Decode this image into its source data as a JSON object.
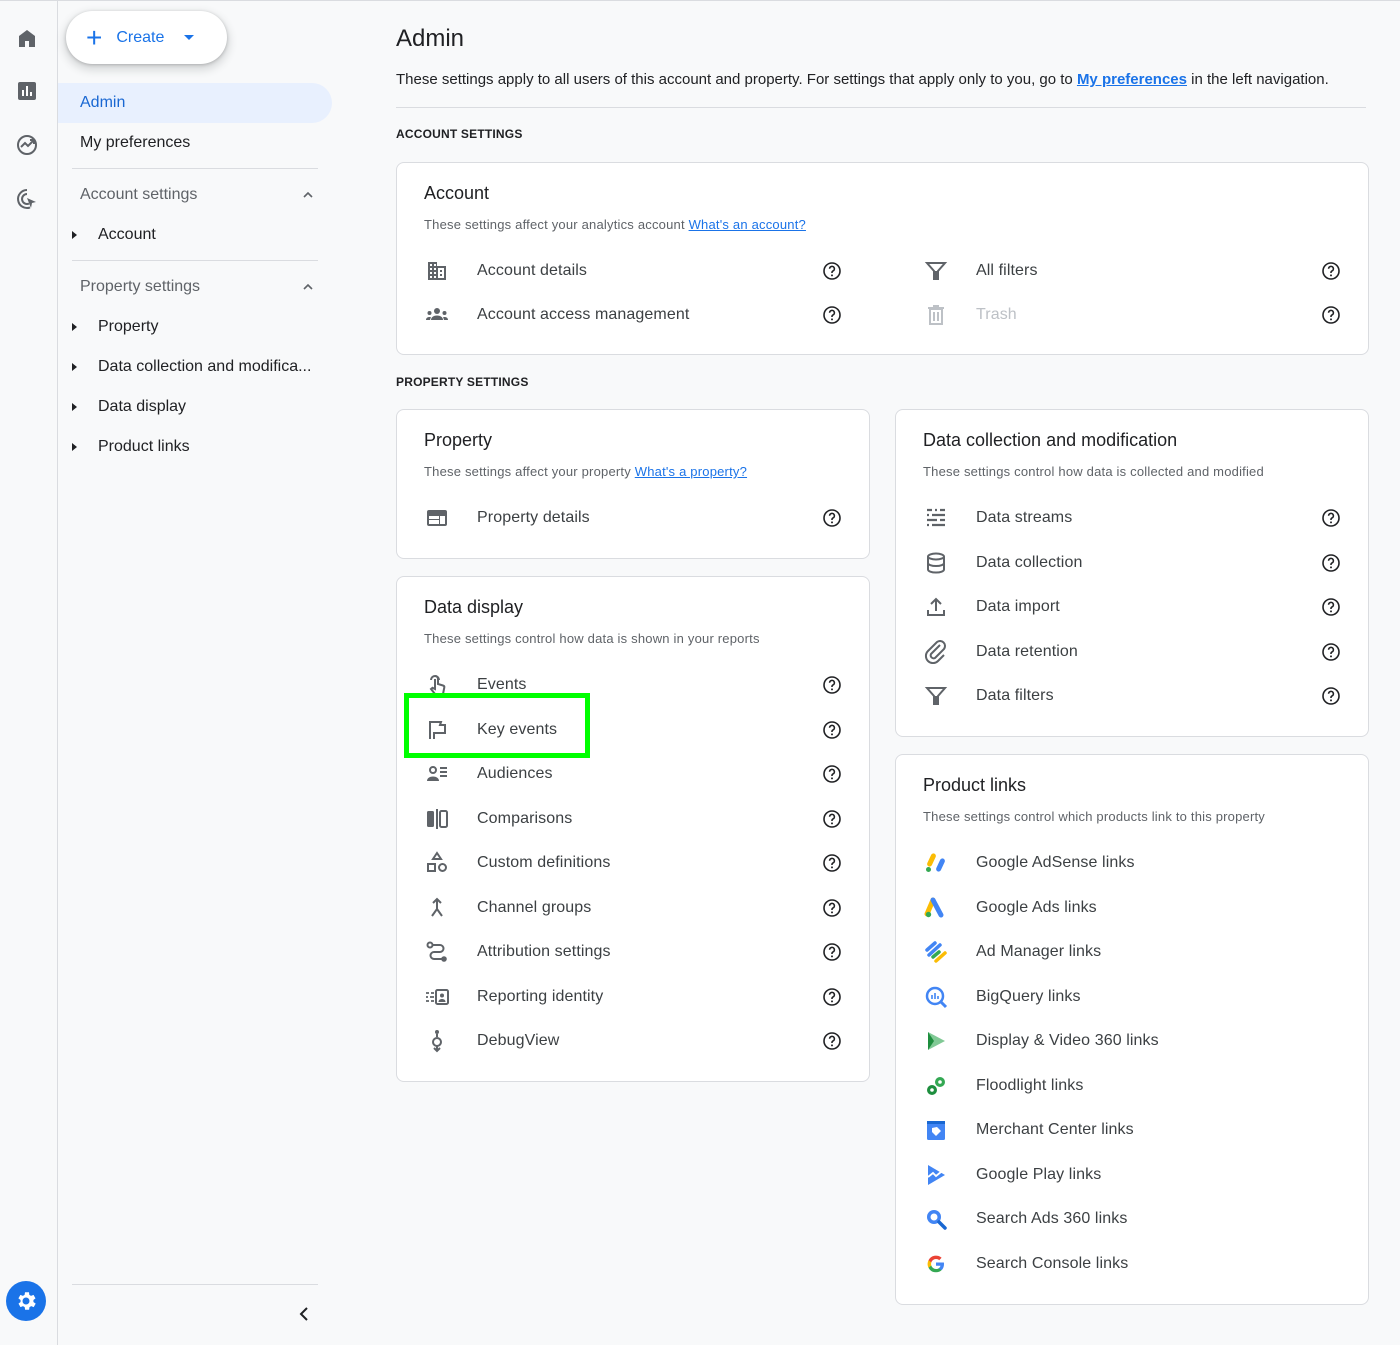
{
  "rail": {
    "items": [
      {
        "icon": "home-icon",
        "label": "Home"
      },
      {
        "icon": "reports-icon",
        "label": "Reports"
      },
      {
        "icon": "explore-icon",
        "label": "Explore"
      },
      {
        "icon": "advertising-icon",
        "label": "Advertising"
      }
    ],
    "settings_icon": "gear-icon"
  },
  "nav": {
    "create_label": "Create",
    "admin_label": "Admin",
    "my_preferences_label": "My preferences",
    "account_settings": {
      "label": "Account settings",
      "items": [
        "Account"
      ]
    },
    "property_settings": {
      "label": "Property settings",
      "items": [
        "Property",
        "Data collection and modifica...",
        "Data display",
        "Product links"
      ]
    }
  },
  "main": {
    "title": "Admin",
    "desc_before": "These settings apply to all users of this account and property. For settings that apply only to you, go to ",
    "desc_link": "My preferences",
    "desc_after": " in the left navigation.",
    "account_section_label": "ACCOUNT SETTINGS",
    "property_section_label": "PROPERTY SETTINGS",
    "account_card": {
      "title": "Account",
      "desc": "These settings affect your analytics account ",
      "desc_link": "What's an account?",
      "left_items": [
        {
          "label": "Account details",
          "icon": "building-icon"
        },
        {
          "label": "Account access management",
          "icon": "group-icon"
        }
      ],
      "right_items": [
        {
          "label": "All filters",
          "icon": "filter-icon",
          "disabled": false
        },
        {
          "label": "Trash",
          "icon": "trash-icon",
          "disabled": true
        }
      ]
    },
    "property_card": {
      "title": "Property",
      "desc": "These settings affect your property ",
      "desc_link": "What's a property?",
      "items": [
        {
          "label": "Property details",
          "icon": "web-layout-icon"
        }
      ]
    },
    "data_display_card": {
      "title": "Data display",
      "desc": "These settings control how data is shown in your reports",
      "items": [
        {
          "label": "Events",
          "icon": "touch-icon"
        },
        {
          "label": "Key events",
          "icon": "flag-icon"
        },
        {
          "label": "Audiences",
          "icon": "audience-icon"
        },
        {
          "label": "Comparisons",
          "icon": "compare-icon"
        },
        {
          "label": "Custom definitions",
          "icon": "shapes-icon"
        },
        {
          "label": "Channel groups",
          "icon": "merge-icon"
        },
        {
          "label": "Attribution settings",
          "icon": "route-icon"
        },
        {
          "label": "Reporting identity",
          "icon": "identity-icon"
        },
        {
          "label": "DebugView",
          "icon": "debug-icon"
        }
      ]
    },
    "data_collection_card": {
      "title": "Data collection and modification",
      "desc": "These settings control how data is collected and modified",
      "items": [
        {
          "label": "Data streams",
          "icon": "streams-icon"
        },
        {
          "label": "Data collection",
          "icon": "database-icon"
        },
        {
          "label": "Data import",
          "icon": "upload-icon"
        },
        {
          "label": "Data retention",
          "icon": "attach-icon"
        },
        {
          "label": "Data filters",
          "icon": "filter-icon"
        }
      ]
    },
    "product_links_card": {
      "title": "Product links",
      "desc": "These settings control which products link to this property",
      "items": [
        {
          "label": "Google AdSense links",
          "icon": "adsense-icon"
        },
        {
          "label": "Google Ads links",
          "icon": "google-ads-icon"
        },
        {
          "label": "Ad Manager links",
          "icon": "ad-manager-icon"
        },
        {
          "label": "BigQuery links",
          "icon": "bigquery-icon"
        },
        {
          "label": "Display & Video 360 links",
          "icon": "dv360-icon"
        },
        {
          "label": "Floodlight links",
          "icon": "floodlight-icon"
        },
        {
          "label": "Merchant Center links",
          "icon": "merchant-center-icon"
        },
        {
          "label": "Google Play links",
          "icon": "google-play-icon"
        },
        {
          "label": "Search Ads 360 links",
          "icon": "search-ads-icon"
        },
        {
          "label": "Search Console links",
          "icon": "google-g-icon"
        }
      ]
    }
  },
  "colors": {
    "accent": "#1a73e8",
    "active_nav_bg": "#e8f0fe",
    "highlight": "#00ff00"
  }
}
